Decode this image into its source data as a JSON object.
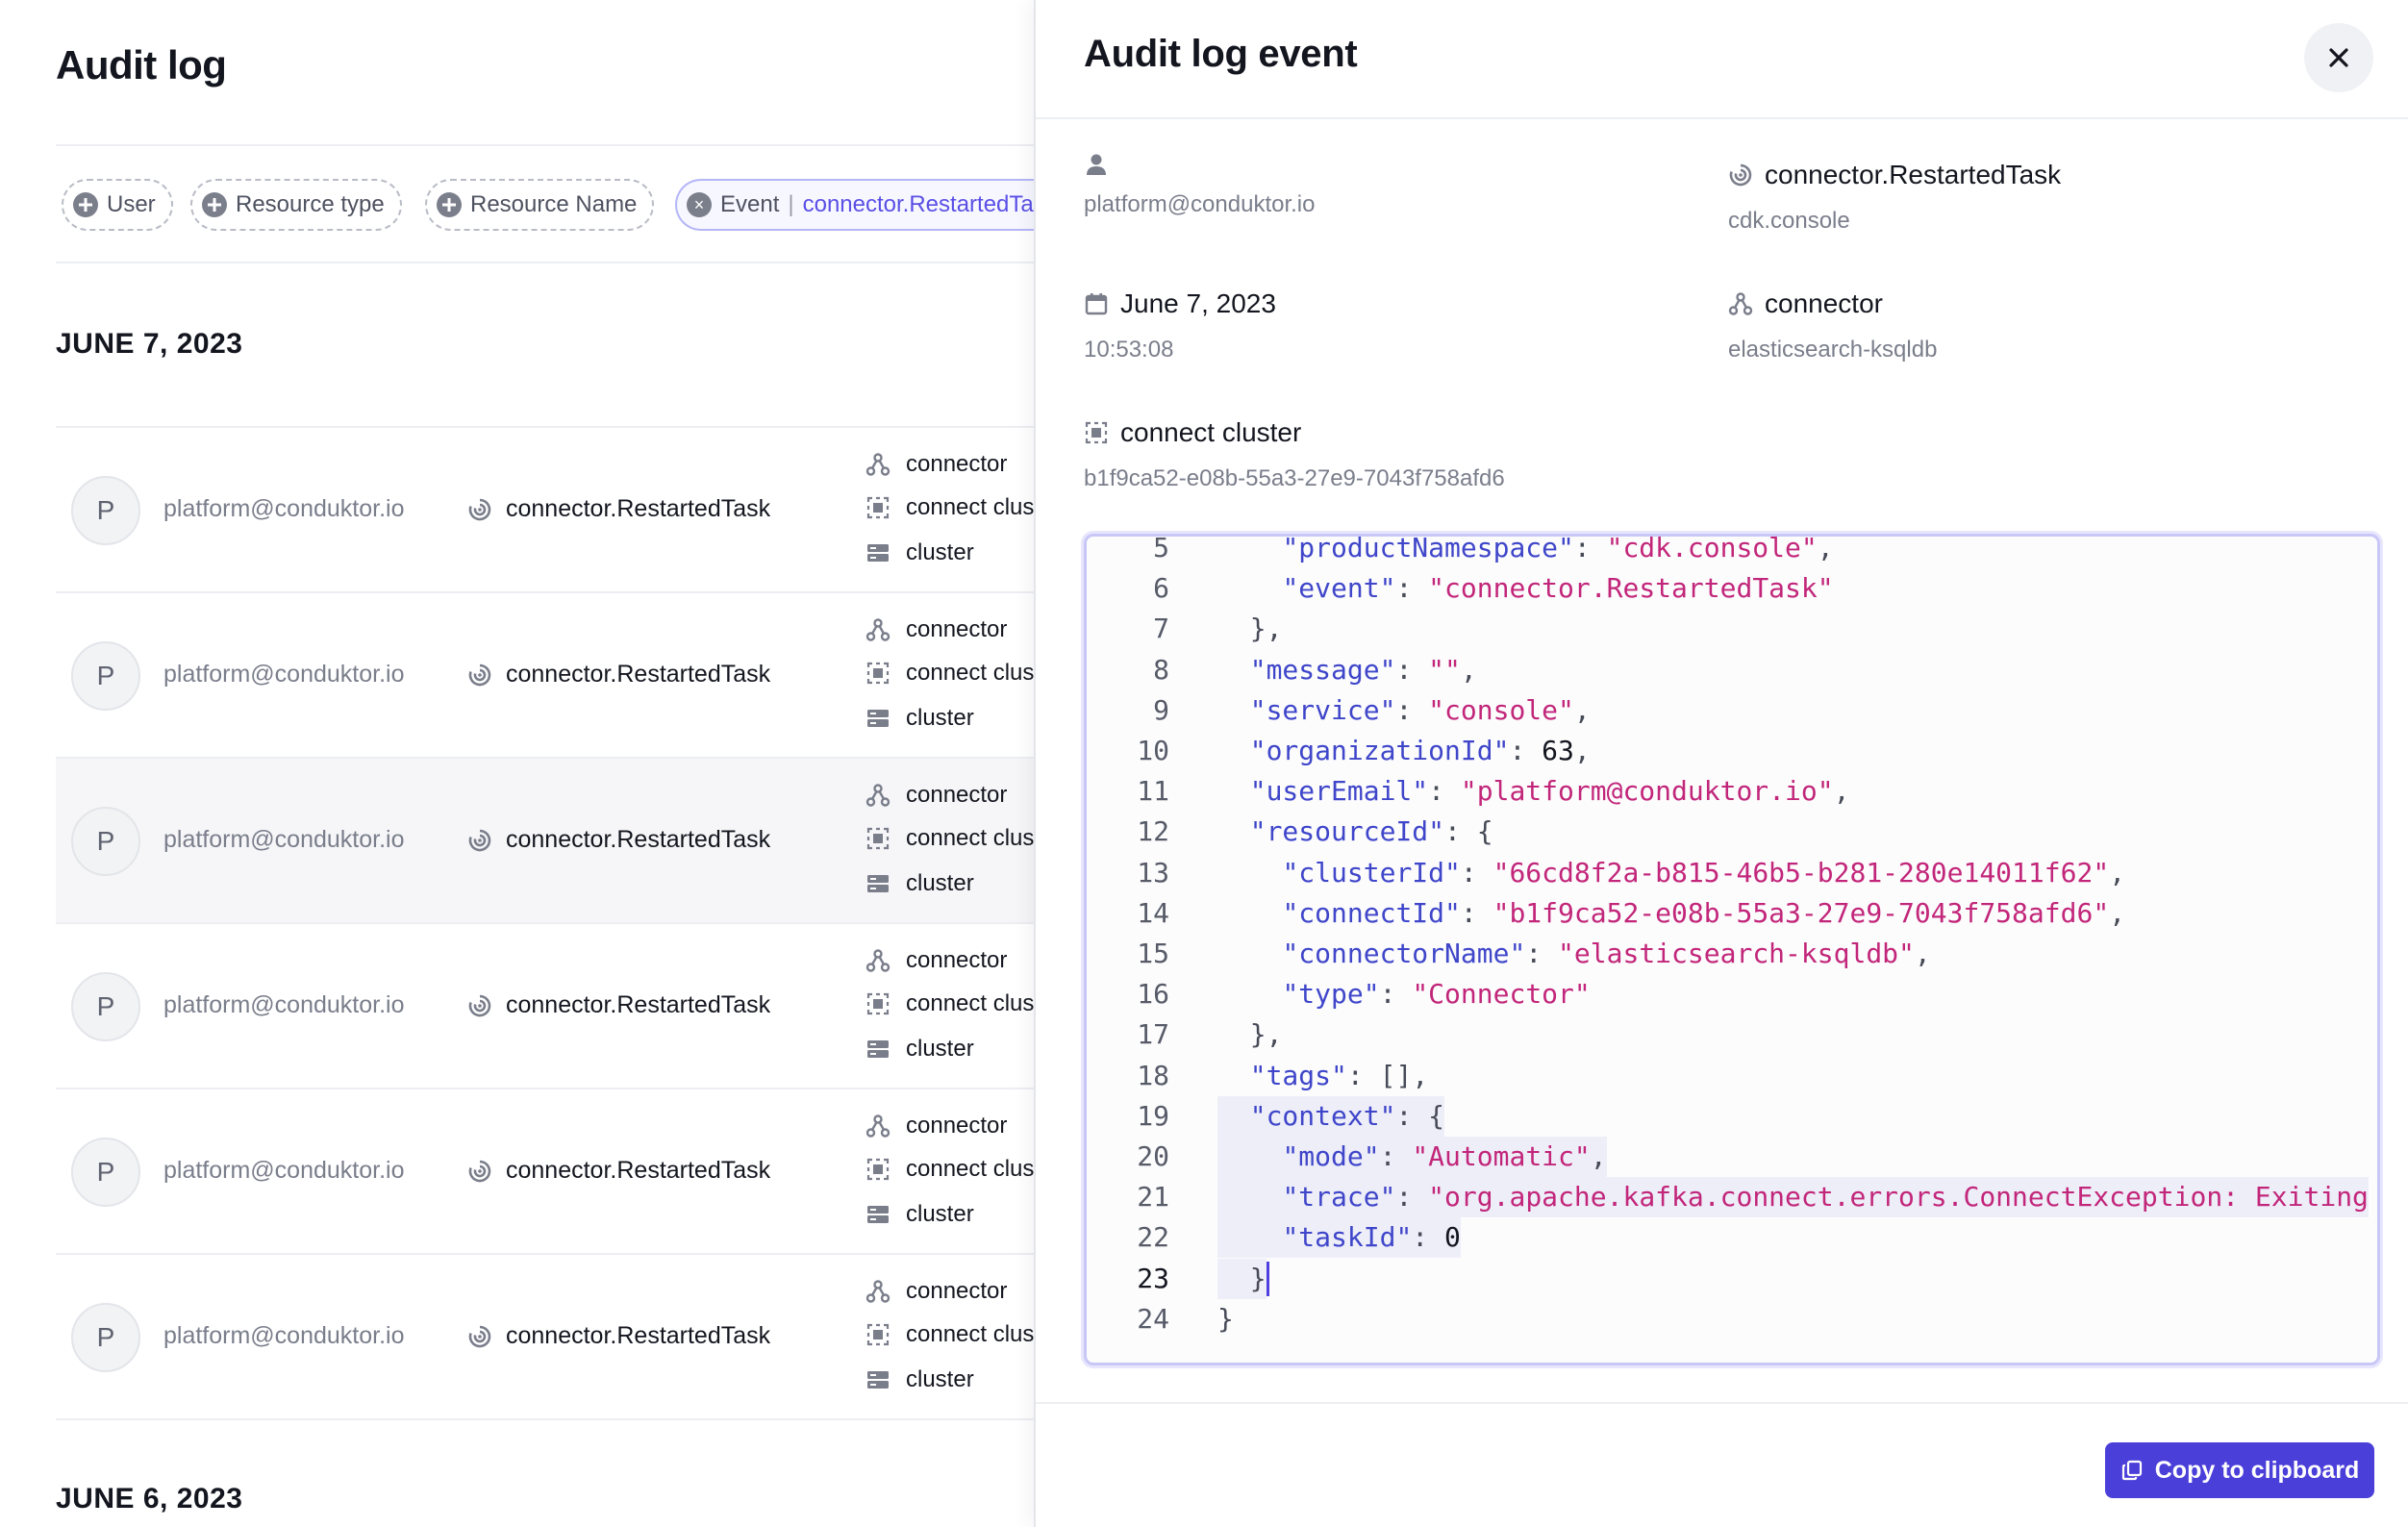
{
  "audit_log": {
    "title": "Audit log",
    "filters": [
      {
        "label": "User",
        "icon": "plus-circle-icon"
      },
      {
        "label": "Resource type",
        "icon": "plus-circle-icon"
      },
      {
        "label": "Resource Name",
        "icon": "plus-circle-icon"
      }
    ],
    "active_filter": {
      "label": "Event",
      "separator": "|",
      "value": "connector.RestartedTask"
    },
    "groups": [
      {
        "date": "JUNE 7, 2023"
      },
      {
        "date": "JUNE 6, 2023"
      }
    ],
    "rows": [
      {
        "avatar": "P",
        "email": "platform@conduktor.io",
        "event": "connector.RestartedTask",
        "resources": [
          "connector",
          "connect cluster",
          "cluster"
        ]
      },
      {
        "avatar": "P",
        "email": "platform@conduktor.io",
        "event": "connector.RestartedTask",
        "resources": [
          "connector",
          "connect cluster",
          "cluster"
        ]
      },
      {
        "avatar": "P",
        "email": "platform@conduktor.io",
        "event": "connector.RestartedTask",
        "resources": [
          "connector",
          "connect cluster",
          "cluster"
        ]
      },
      {
        "avatar": "P",
        "email": "platform@conduktor.io",
        "event": "connector.RestartedTask",
        "resources": [
          "connector",
          "connect cluster",
          "cluster"
        ]
      },
      {
        "avatar": "P",
        "email": "platform@conduktor.io",
        "event": "connector.RestartedTask",
        "resources": [
          "connector",
          "connect cluster",
          "cluster"
        ]
      },
      {
        "avatar": "P",
        "email": "platform@conduktor.io",
        "event": "connector.RestartedTask",
        "resources": [
          "connector",
          "connect cluster",
          "cluster"
        ]
      }
    ]
  },
  "drawer": {
    "title": "Audit log event",
    "user": {
      "email": "platform@conduktor.io"
    },
    "event": {
      "name": "connector.RestartedTask",
      "namespace": "cdk.console"
    },
    "date": {
      "day": "June 7, 2023",
      "time": "10:53:08"
    },
    "connector": {
      "label": "connector",
      "name": "elasticsearch-ksqldb"
    },
    "connect_cluster": {
      "label": "connect cluster",
      "id": "b1f9ca52-e08b-55a3-27e9-7043f758afd6"
    },
    "code": {
      "active_line": 23,
      "lines": [
        {
          "n": 5,
          "text": "    \"productNamespace\": \"cdk.console\","
        },
        {
          "n": 6,
          "text": "    \"event\": \"connector.RestartedTask\""
        },
        {
          "n": 7,
          "text": "  },"
        },
        {
          "n": 8,
          "text": "  \"message\": \"\","
        },
        {
          "n": 9,
          "text": "  \"service\": \"console\","
        },
        {
          "n": 10,
          "text": "  \"organizationId\": 63,"
        },
        {
          "n": 11,
          "text": "  \"userEmail\": \"platform@conduktor.io\","
        },
        {
          "n": 12,
          "text": "  \"resourceId\": {"
        },
        {
          "n": 13,
          "text": "    \"clusterId\": \"66cd8f2a-b815-46b5-b281-280e14011f62\","
        },
        {
          "n": 14,
          "text": "    \"connectId\": \"b1f9ca52-e08b-55a3-27e9-7043f758afd6\","
        },
        {
          "n": 15,
          "text": "    \"connectorName\": \"elasticsearch-ksqldb\","
        },
        {
          "n": 16,
          "text": "    \"type\": \"Connector\""
        },
        {
          "n": 17,
          "text": "  },"
        },
        {
          "n": 18,
          "text": "  \"tags\": [],"
        },
        {
          "n": 19,
          "text": "  \"context\": {"
        },
        {
          "n": 20,
          "text": "    \"mode\": \"Automatic\","
        },
        {
          "n": 21,
          "text": "    \"trace\": \"org.apache.kafka.connect.errors.ConnectException: Exiting"
        },
        {
          "n": 22,
          "text": "    \"taskId\": 0"
        },
        {
          "n": 23,
          "text": "  }"
        },
        {
          "n": 24,
          "text": "}"
        }
      ]
    },
    "copy_button": "Copy to clipboard"
  },
  "colors": {
    "accent": "#4b3fd9",
    "json_key": "#3f46c9",
    "json_string": "#c2267a"
  }
}
